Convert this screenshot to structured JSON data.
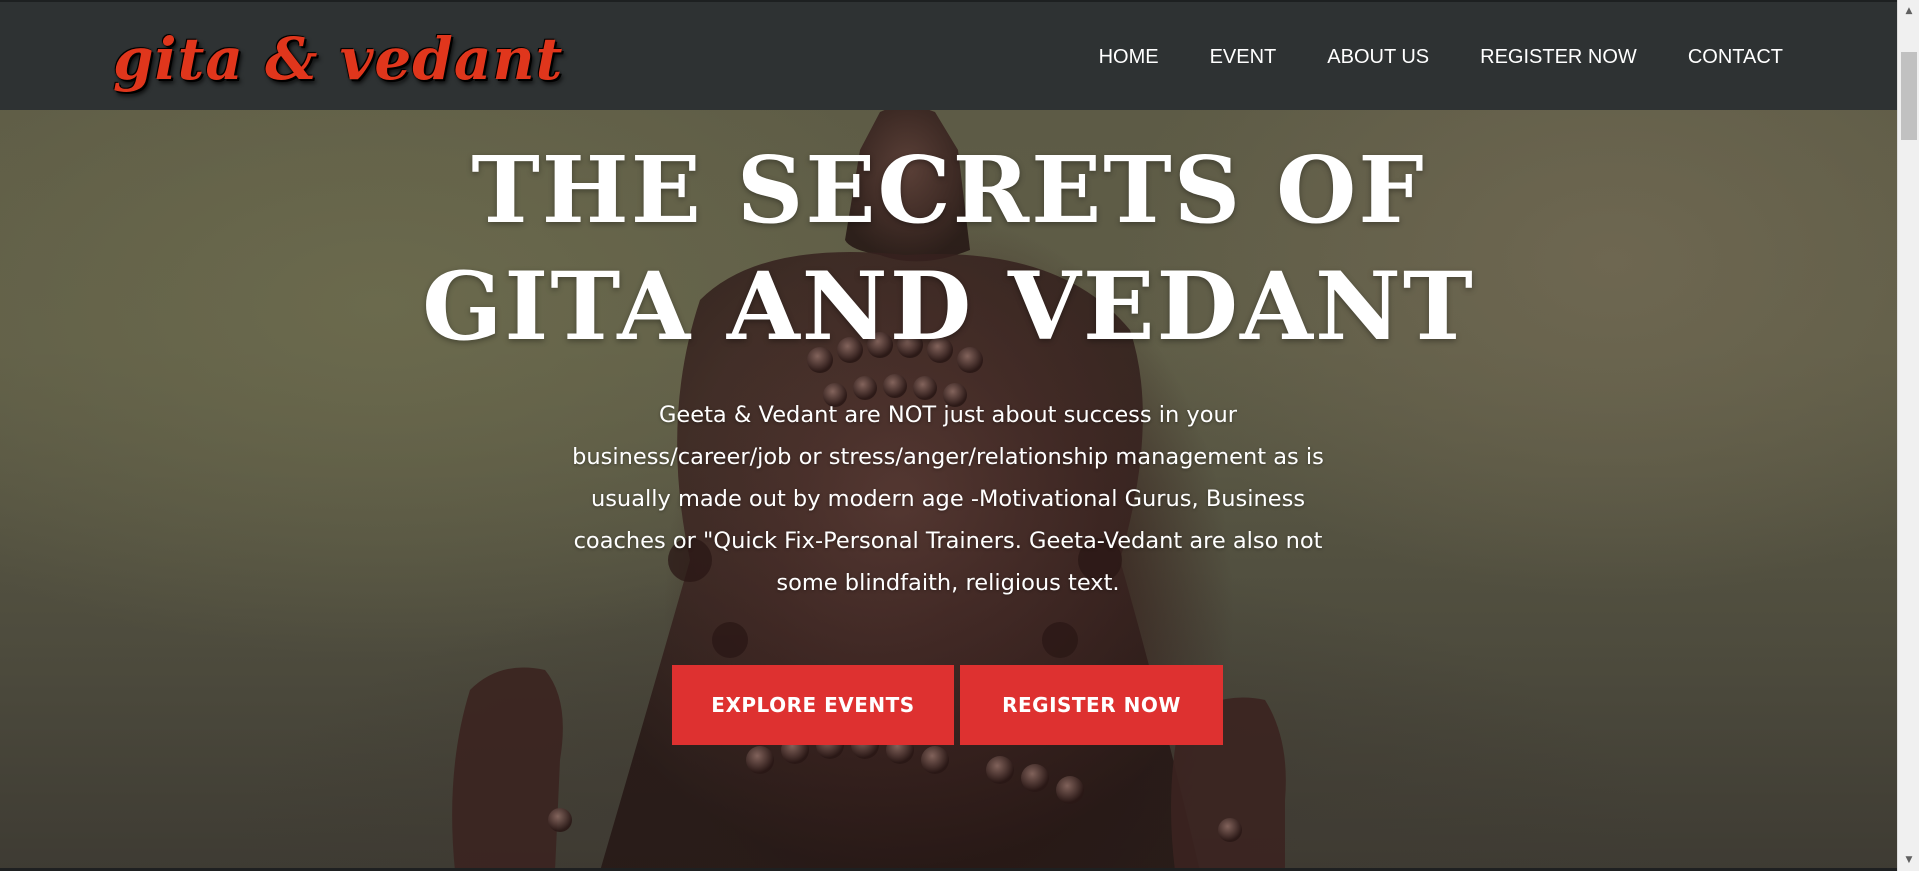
{
  "brand": {
    "logo_text": "gita & vedant",
    "logo_color": "#e0361c"
  },
  "nav": {
    "items": [
      {
        "label": "HOME"
      },
      {
        "label": "EVENT"
      },
      {
        "label": "ABOUT US"
      },
      {
        "label": "REGISTER NOW"
      },
      {
        "label": "CONTACT"
      }
    ]
  },
  "hero": {
    "headline_line1": "THE SECRETS OF",
    "headline_line2": "GITA AND VEDANT",
    "intro": "Geeta & Vedant are NOT just about success in your business/career/job or stress/anger/relationship management as is usually made out by modern age -Motivational Gurus, Business coaches or \"Quick Fix-Personal Trainers. Geeta-Vedant are also not some blindfaith, religious text.",
    "buttons": {
      "explore_label": "EXPLORE EVENTS",
      "register_label": "REGISTER NOW"
    },
    "accent_color": "#de3130"
  },
  "scrollbar": {
    "up_icon": "scroll-up-arrow",
    "down_icon": "scroll-down-arrow"
  }
}
